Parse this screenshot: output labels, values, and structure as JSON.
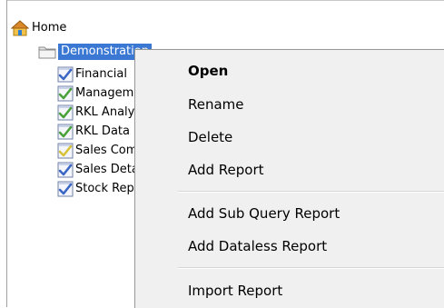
{
  "tree": {
    "root": {
      "label": "Home",
      "icon": "home-icon"
    },
    "folder": {
      "label": "Demonstration",
      "icon": "folder-icon"
    },
    "reports": [
      {
        "label": "Financial",
        "icon": "report-check-blue-icon",
        "check_color": "#3a66c4"
      },
      {
        "label": "Management",
        "icon": "report-check-green-icon",
        "check_color": "#4aa13a"
      },
      {
        "label": "RKL Analysis",
        "icon": "report-check-green-icon",
        "check_color": "#4aa13a"
      },
      {
        "label": "RKL Data",
        "icon": "report-check-green-icon",
        "check_color": "#4aa13a"
      },
      {
        "label": "Sales Comparison",
        "icon": "report-check-yellow-icon",
        "check_color": "#d8c23a"
      },
      {
        "label": "Sales Detail",
        "icon": "report-check-blue-icon",
        "check_color": "#3a66c4"
      },
      {
        "label": "Stock Report",
        "icon": "report-check-blue-icon",
        "check_color": "#3a66c4"
      }
    ]
  },
  "context_menu": {
    "items": [
      {
        "label": "Open",
        "bold": true
      },
      {
        "label": "Rename"
      },
      {
        "label": "Delete"
      },
      {
        "label": "Add Report"
      },
      {
        "label": "Add Sub Query Report"
      },
      {
        "label": "Add Dataless Report"
      },
      {
        "label": "Import Report"
      }
    ]
  },
  "colors": {
    "selection": "#3a78d4",
    "menu_background": "#f0f0f0"
  }
}
